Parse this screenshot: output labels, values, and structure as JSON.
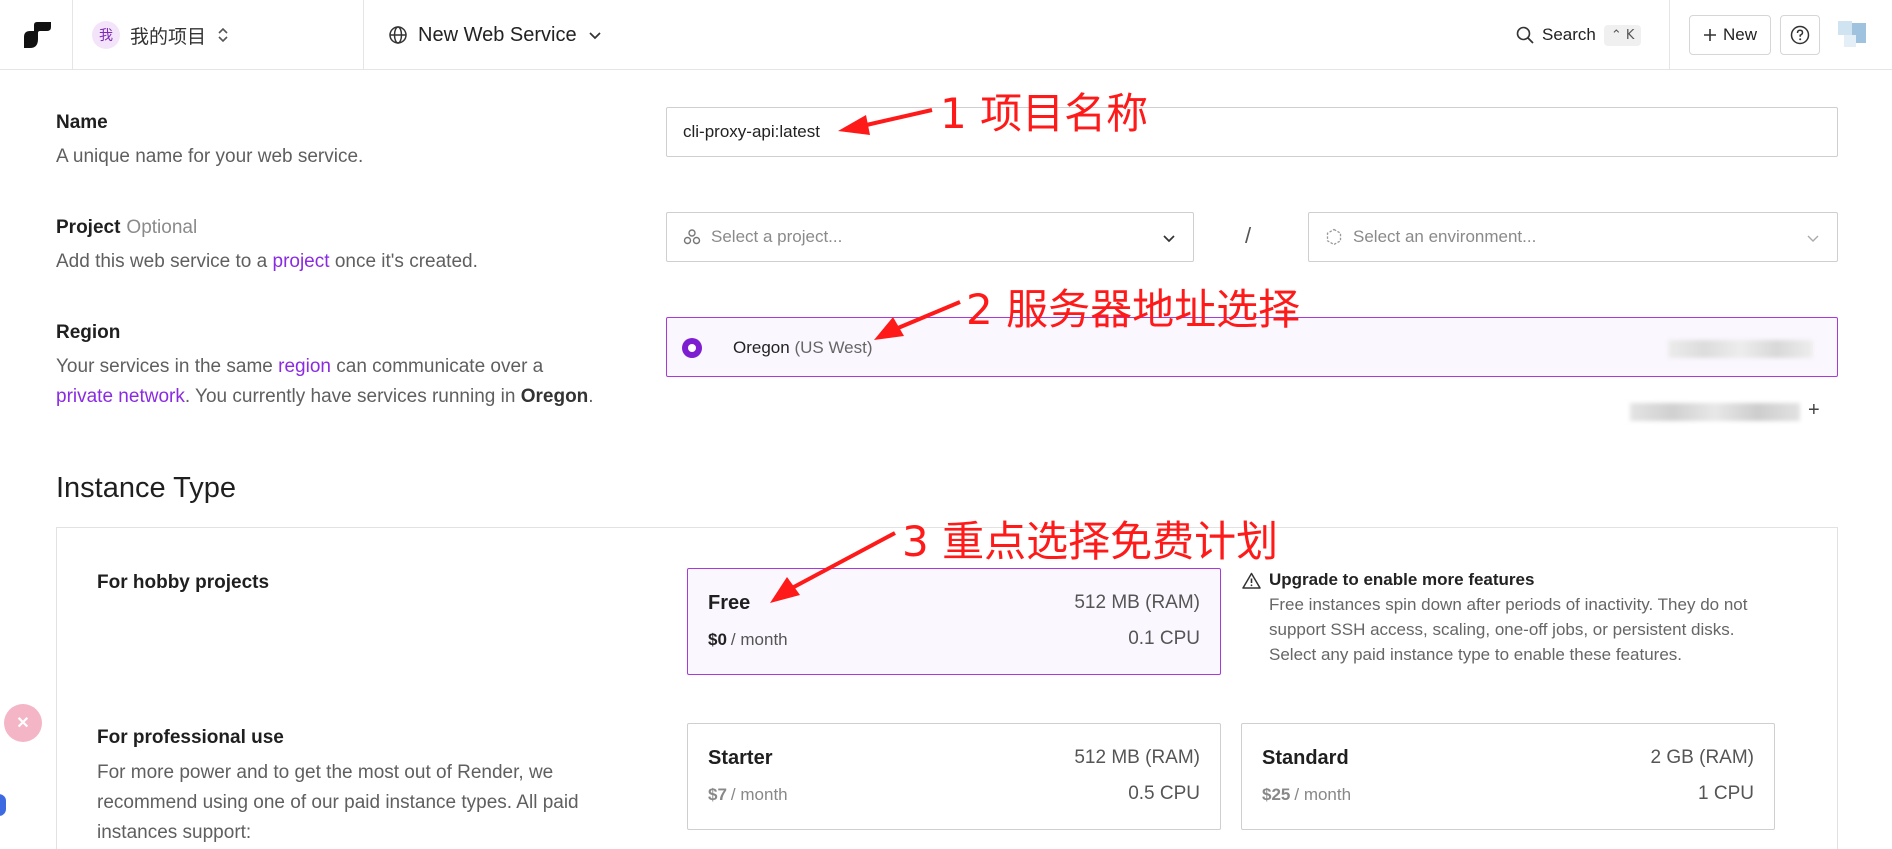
{
  "topbar": {
    "workspace_avatar": "我",
    "workspace_name": "我的项目",
    "service_label": "New Web Service",
    "search_label": "Search",
    "search_shortcut": "⌃ K",
    "new_label": "New"
  },
  "name_field": {
    "label": "Name",
    "description": "A unique name for your web service.",
    "value": "cli-proxy-api:latest"
  },
  "project_field": {
    "label": "Project",
    "optional": "Optional",
    "desc_before": "Add this web service to a",
    "desc_link": "project",
    "desc_after": "once it's created.",
    "project_placeholder": "Select a project...",
    "separator": "/",
    "environment_placeholder": "Select an environment..."
  },
  "region_field": {
    "label": "Region",
    "desc_1": "Your services in the same",
    "desc_link_1": "region",
    "desc_2": "can communicate over a",
    "desc_link_2": "private network",
    "desc_3": ". You currently have services running in",
    "desc_bold": "Oregon",
    "desc_4": ".",
    "selected_name": "Oregon",
    "selected_sub": "(US West)",
    "add_symbol": "+"
  },
  "instance_type": {
    "title": "Instance Type",
    "hobby_heading": "For hobby projects",
    "pro_heading": "For professional use",
    "pro_description": "For more power and to get the most out of Render, we recommend using one of our paid instance types. All paid instances support:",
    "cards": [
      {
        "name": "Free",
        "price": "$0",
        "per": "/ month",
        "ram": "512 MB (RAM)",
        "cpu": "0.1 CPU"
      },
      {
        "name": "Starter",
        "price": "$7",
        "per": "/ month",
        "ram": "512 MB (RAM)",
        "cpu": "0.5 CPU"
      },
      {
        "name": "Standard",
        "price": "$25",
        "per": "/ month",
        "ram": "2 GB (RAM)",
        "cpu": "1 CPU"
      }
    ],
    "upgrade_title": "Upgrade to enable more features",
    "upgrade_text": "Free instances spin down after periods of inactivity. They do not support SSH access, scaling, one-off jobs, or persistent disks. Select any paid instance type to enable these features."
  },
  "annotations": {
    "a1": "1 项目名称",
    "a2": "2 服务器地址选择",
    "a3": "3 重点选择免费计划"
  },
  "colors": {
    "accent": "#8a2be2",
    "radio": "#7d1ed1",
    "selected_border": "#a83ad8",
    "annotation": "#ff1a1a"
  },
  "icons": [
    "logo-icon",
    "chevron-updown-icon",
    "globe-icon",
    "chevron-down-icon",
    "search-icon",
    "plus-icon",
    "help-icon",
    "project-icon",
    "environment-icon",
    "warning-icon",
    "translate-icon"
  ]
}
